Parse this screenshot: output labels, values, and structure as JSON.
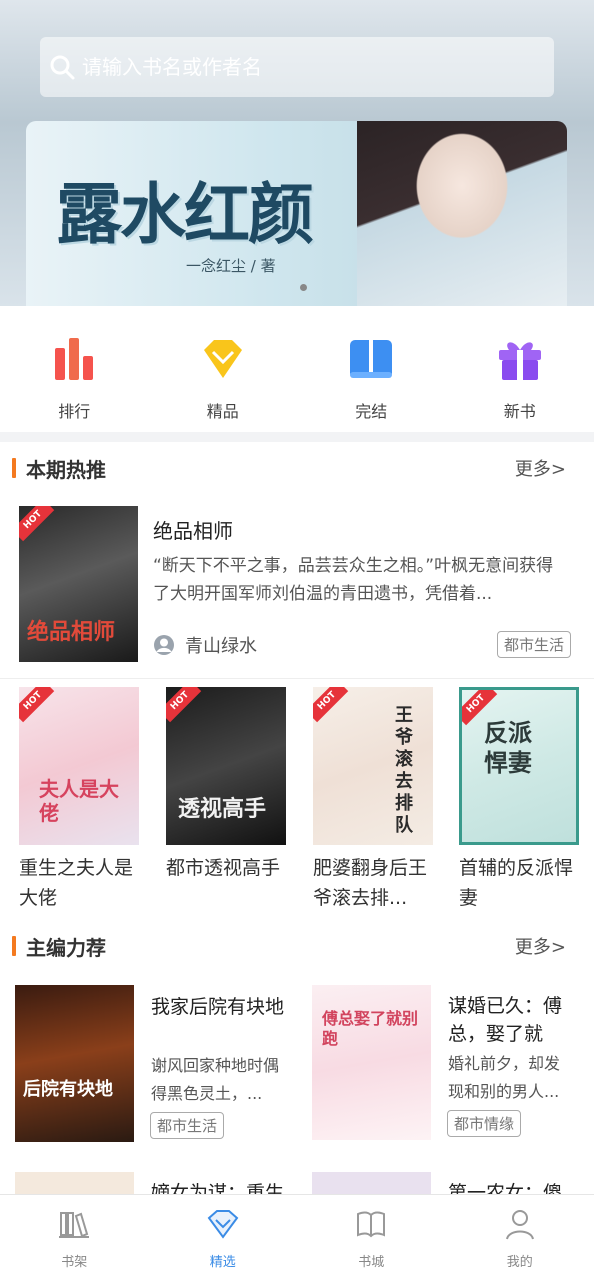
{
  "search": {
    "placeholder": "请输入书名或作者名"
  },
  "banner": {
    "title": "露水红颜",
    "author": "一念红尘 / 著"
  },
  "categories": [
    {
      "label": "排行",
      "icon": "bar-chart-icon"
    },
    {
      "label": "精品",
      "icon": "diamond-icon"
    },
    {
      "label": "完结",
      "icon": "book-open-icon"
    },
    {
      "label": "新书",
      "icon": "gift-icon"
    }
  ],
  "hot": {
    "title": "本期热推",
    "more": "更多>",
    "featured": {
      "title": "绝品相师",
      "desc": "“断天下不平之事，品芸芸众生之相。”叶枫无意间获得了大明开国军师刘伯温的青田遗书，凭借着...",
      "author": "青山绿水",
      "tag": "都市生活",
      "cover_text": "绝品相师"
    },
    "books": [
      {
        "title": "重生之夫人是大佬",
        "cover_text": "夫人是大佬"
      },
      {
        "title": "都市透视高手",
        "cover_text": "透视高手"
      },
      {
        "title": "肥婆翻身后王爷滚去排...",
        "cover_text": "王爷滚去排队"
      },
      {
        "title": "首辅的反派悍妻",
        "cover_text": "反派悍妻"
      }
    ],
    "hot_label": "HOT"
  },
  "editor": {
    "title": "主编力荐",
    "more": "更多>",
    "books": [
      {
        "title": "我家后院有块地",
        "desc": "谢风回家种地时偶得黑色灵土，...",
        "tag": "都市生活",
        "cover_text": "后院有块地"
      },
      {
        "title": "谋婚已久：傅总，娶了就",
        "desc": "婚礼前夕，却发现和别的男人...",
        "tag": "都市情缘",
        "cover_text": "傅总娶了就别跑"
      },
      {
        "title": "嫡女为谋：重生"
      },
      {
        "title": "第一农女：傻"
      }
    ]
  },
  "nav": [
    {
      "label": "书架",
      "icon": "bookshelf-icon",
      "active": false
    },
    {
      "label": "精选",
      "icon": "diamond-outline-icon",
      "active": true
    },
    {
      "label": "书城",
      "icon": "book-icon",
      "active": false
    },
    {
      "label": "我的",
      "icon": "person-icon",
      "active": false
    }
  ],
  "colors": {
    "accent": "#f47a20",
    "active": "#3b8ce6",
    "hot": "#e6333a"
  }
}
